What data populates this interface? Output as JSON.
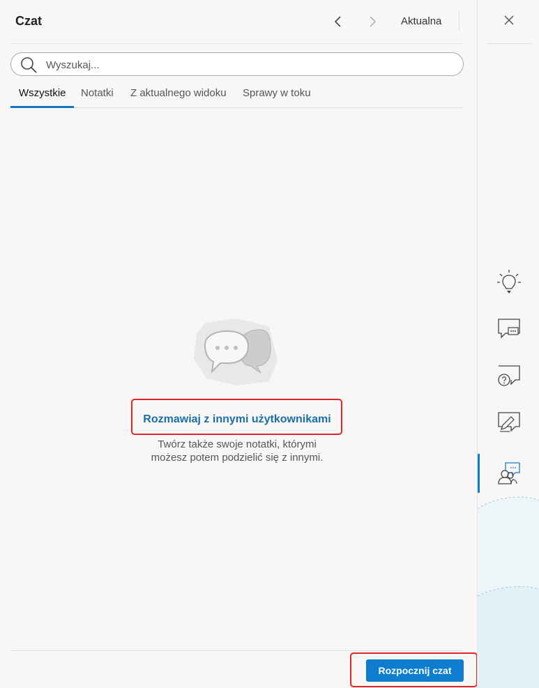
{
  "header": {
    "title": "Czat",
    "current_label": "Aktualna"
  },
  "search": {
    "placeholder": "Wyszukaj..."
  },
  "tabs": [
    {
      "label": "Wszystkie",
      "active": true
    },
    {
      "label": "Notatki",
      "active": false
    },
    {
      "label": "Z aktualnego widoku",
      "active": false
    },
    {
      "label": "Sprawy w toku",
      "active": false
    }
  ],
  "empty_state": {
    "title": "Rozmawiaj z innymi użytkownikami",
    "line1": "Twórz także swoje notatki, którymi",
    "line2": "możesz potem podzielić się z innymi."
  },
  "footer": {
    "start_label": "Rozpocznij czat"
  },
  "rail": {
    "icons": [
      "lightbulb-icon",
      "chat-bubble-icon",
      "question-chat-icon",
      "edit-chat-icon",
      "users-chat-icon"
    ],
    "active": "users-chat-icon"
  },
  "colors": {
    "accent": "#0e7dd0",
    "link": "#1a6ea8",
    "highlight_box": "#e0262a"
  }
}
